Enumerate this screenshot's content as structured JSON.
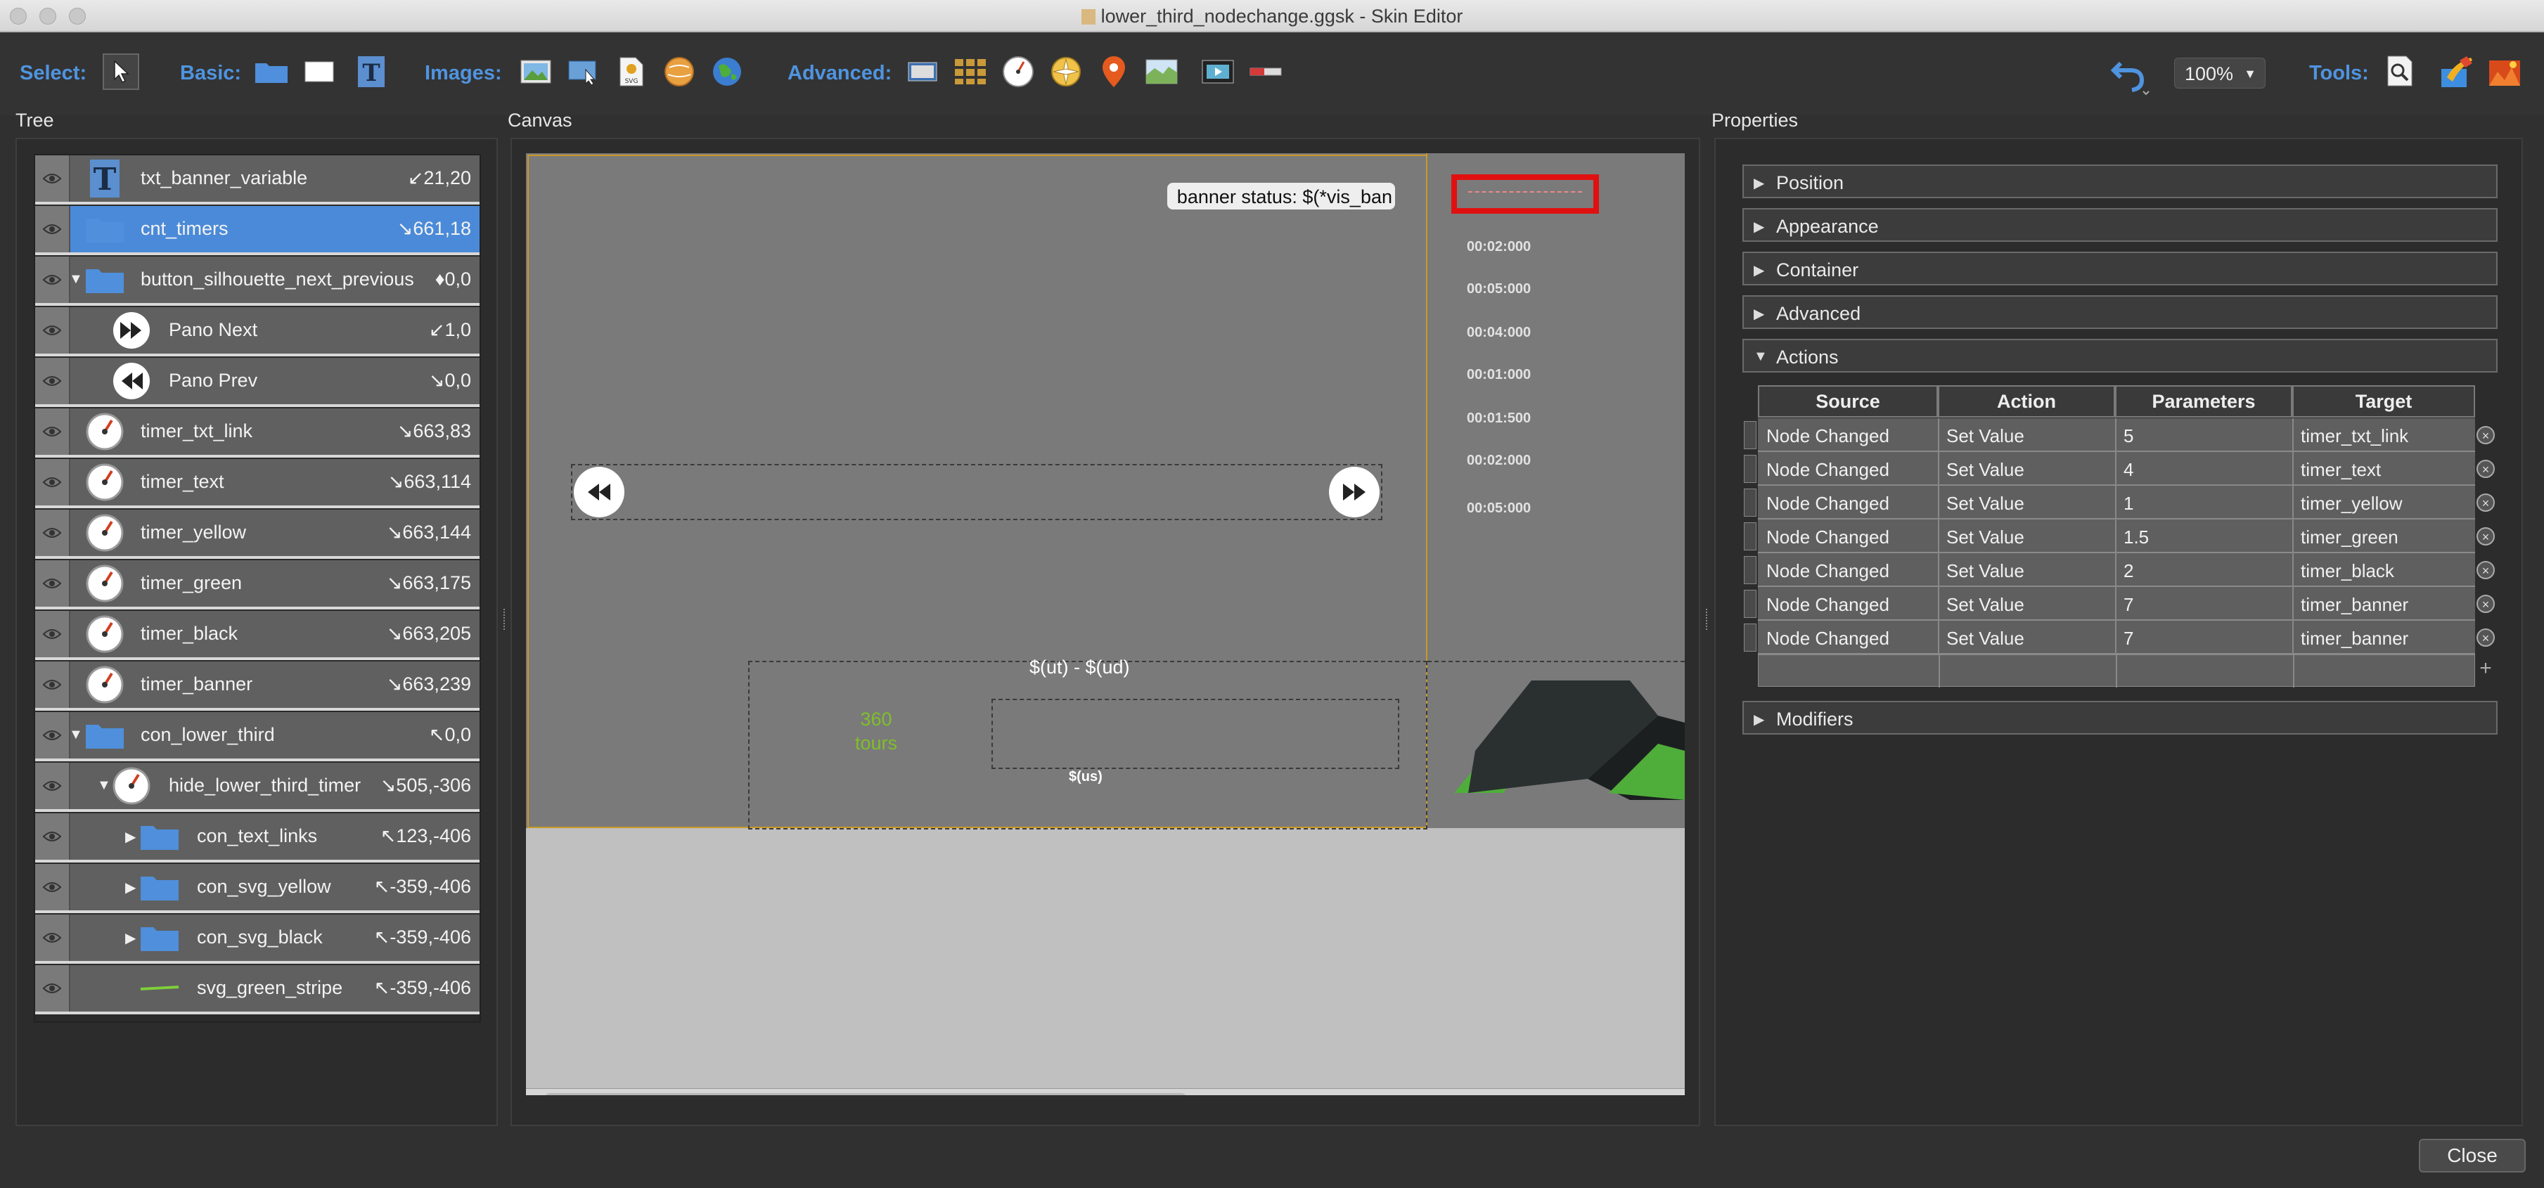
{
  "window": {
    "title": "lower_third_nodechange.ggsk - Skin Editor"
  },
  "toolbar": {
    "select_label": "Select:",
    "basic_label": "Basic:",
    "images_label": "Images:",
    "advanced_label": "Advanced:",
    "zoom": "100%",
    "tools_label": "Tools:"
  },
  "panels": {
    "tree": "Tree",
    "canvas": "Canvas",
    "properties": "Properties"
  },
  "tree": {
    "rows": [
      {
        "label": "txt_banner_variable",
        "coords": "↙21,20",
        "icon": "text-icon"
      },
      {
        "label": "cnt_timers",
        "coords": "↘661,18",
        "icon": "folder-icon",
        "selected": true
      },
      {
        "label": "button_silhouette_next_previous",
        "coords": "♦0,0",
        "icon": "folder-icon"
      },
      {
        "label": "Pano Next",
        "coords": "↙1,0",
        "icon": "next-icon"
      },
      {
        "label": "Pano Prev",
        "coords": "↘0,0",
        "icon": "prev-icon"
      },
      {
        "label": "timer_txt_link",
        "coords": "↘663,83",
        "icon": "timer-icon"
      },
      {
        "label": "timer_text",
        "coords": "↘663,114",
        "icon": "timer-icon"
      },
      {
        "label": "timer_yellow",
        "coords": "↘663,144",
        "icon": "timer-icon"
      },
      {
        "label": "timer_green",
        "coords": "↘663,175",
        "icon": "timer-icon"
      },
      {
        "label": "timer_black",
        "coords": "↘663,205",
        "icon": "timer-icon"
      },
      {
        "label": "timer_banner",
        "coords": "↘663,239",
        "icon": "timer-icon"
      },
      {
        "label": "con_lower_third",
        "coords": "↖0,0",
        "icon": "folder-icon"
      },
      {
        "label": "hide_lower_third_timer",
        "coords": "↘505,-306",
        "icon": "timer-icon"
      },
      {
        "label": "con_text_links",
        "coords": "↖123,-406",
        "icon": "folder-icon"
      },
      {
        "label": "con_svg_yellow",
        "coords": "↖-359,-406",
        "icon": "folder-icon"
      },
      {
        "label": "con_svg_black",
        "coords": "↖-359,-406",
        "icon": "folder-icon"
      },
      {
        "label": "svg_green_stripe",
        "coords": "↖-359,-406",
        "icon": "stripe-icon"
      }
    ]
  },
  "canvas": {
    "banner_text": "banner status: $(*vis_ban",
    "timers": [
      "00:02:000",
      "00:05:000",
      "00:04:000",
      "00:01:000",
      "00:01:500",
      "00:02:000",
      "00:05:000"
    ],
    "ut_ud": "$(ut) - $(ud)",
    "tours_number": "360",
    "tours_label": "tours",
    "us_text": "$(us)"
  },
  "properties": {
    "sections": [
      "Position",
      "Appearance",
      "Container",
      "Advanced",
      "Actions"
    ],
    "modifiers": "Modifiers",
    "actions_columns": [
      "Source",
      "Action",
      "Parameters",
      "Target"
    ],
    "actions": [
      {
        "source": "Node Changed",
        "action": "Set Value",
        "param": "5",
        "target": "timer_txt_link"
      },
      {
        "source": "Node Changed",
        "action": "Set Value",
        "param": "4",
        "target": "timer_text"
      },
      {
        "source": "Node Changed",
        "action": "Set Value",
        "param": "1",
        "target": "timer_yellow"
      },
      {
        "source": "Node Changed",
        "action": "Set Value",
        "param": "1.5",
        "target": "timer_green"
      },
      {
        "source": "Node Changed",
        "action": "Set Value",
        "param": "2",
        "target": "timer_black"
      },
      {
        "source": "Node Changed",
        "action": "Set Value",
        "param": "7",
        "target": "timer_banner"
      },
      {
        "source": "Node Changed",
        "action": "Set Value",
        "param": "7",
        "target": "timer_banner"
      }
    ]
  },
  "footer": {
    "close": "Close"
  },
  "colors": {
    "accent": "#4f94e0",
    "selection": "#4b8ad8",
    "green_text": "#7fbf2a",
    "highlight_red": "#e01010"
  }
}
